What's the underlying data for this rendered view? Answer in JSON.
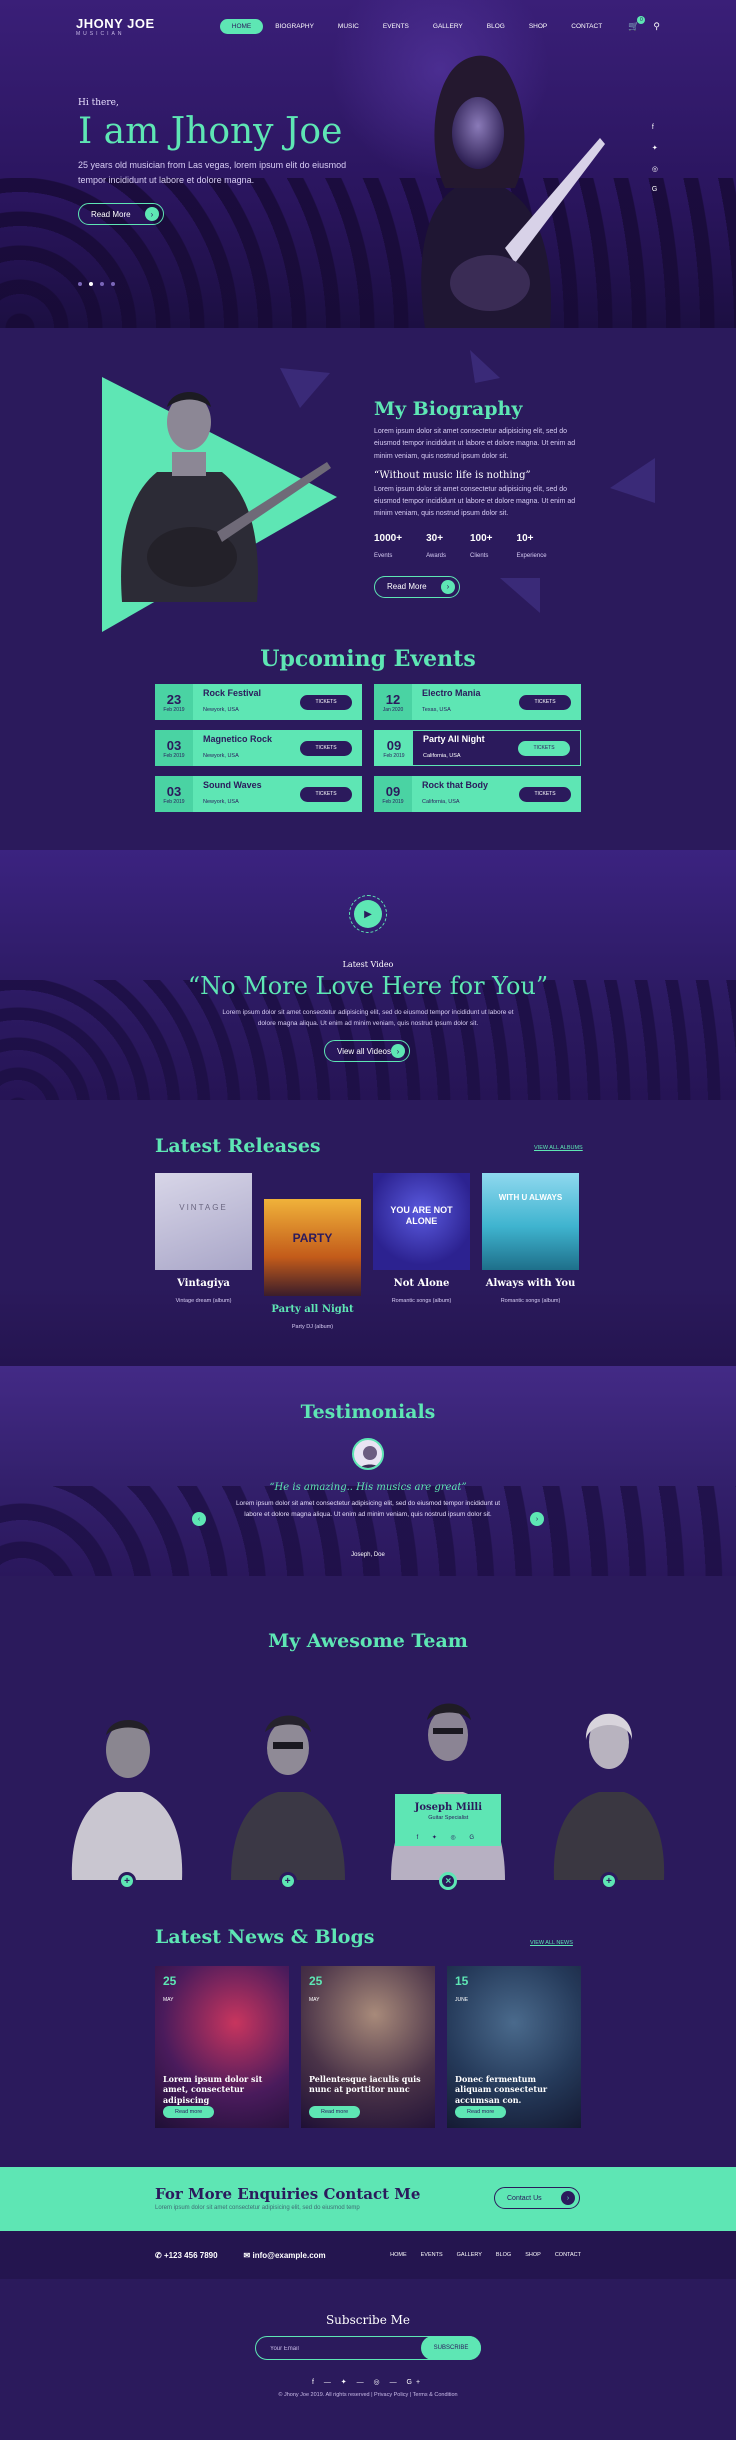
{
  "nav": {
    "logo": "JHONY JOE",
    "logo_sub": "MUSICIAN",
    "items": [
      "HOME",
      "BIOGRAPHY",
      "MUSIC",
      "EVENTS",
      "GALLERY",
      "BLOG",
      "SHOP",
      "CONTACT"
    ],
    "cart_count": "0"
  },
  "hero": {
    "greeting": "Hi there,",
    "title": "I am Jhony Joe",
    "desc": "25 years old musician from Las vegas, lorem ipsum elit do eiusmod tempor incididunt ut labore et dolore magna.",
    "button": "Read More"
  },
  "bio": {
    "title": "My Biography",
    "desc1": "Lorem ipsum dolor sit amet consectetur adipisicing elit, sed do eiusmod tempor incididunt ut labore et dolore magna. Ut enim ad minim veniam, quis nostrud ipsum dolor sit.",
    "quote": "“Without music life is nothing”",
    "desc2": "Lorem ipsum dolor sit amet consectetur adipisicing elit, sed do eiusmod tempor incididunt ut labore et dolore magna. Ut enim ad minim veniam, quis nostrud ipsum dolor sit.",
    "stats": [
      {
        "value": "1000+",
        "label": "Events"
      },
      {
        "value": "30+",
        "label": "Awards"
      },
      {
        "value": "100+",
        "label": "Clients"
      },
      {
        "value": "10+",
        "label": "Experience"
      }
    ],
    "button": "Read More"
  },
  "events": {
    "title": "Upcoming Events",
    "ticket_label": "TICKETS",
    "items": [
      {
        "day": "23",
        "month": "Feb 2019",
        "name": "Rock Festival",
        "place": "Newyork, USA"
      },
      {
        "day": "12",
        "month": "Jan 2020",
        "name": "Electro Mania",
        "place": "Texas, USA"
      },
      {
        "day": "03",
        "month": "Feb 2019",
        "name": "Magnetico Rock",
        "place": "Newyork, USA"
      },
      {
        "day": "09",
        "month": "Feb 2019",
        "name": "Party All Night",
        "place": "California, USA"
      },
      {
        "day": "03",
        "month": "Feb 2019",
        "name": "Sound Waves",
        "place": "Newyork, USA"
      },
      {
        "day": "09",
        "month": "Feb 2019",
        "name": "Rock that Body",
        "place": "California, USA"
      }
    ]
  },
  "video": {
    "label": "Latest Video",
    "title": "“No More Love Here for You”",
    "desc": "Lorem ipsum dolor sit amet consectetur adipisicing elit, sed do eiusmod tempor incididunt ut labore et dolore magna aliqua. Ut enim ad minim veniam, quis nostrud ipsum dolor sit.",
    "button": "View all Videos"
  },
  "releases": {
    "title": "Latest Releases",
    "view_all": "VIEW ALL ALBUMS",
    "items": [
      {
        "name": "Vintagiya",
        "sub": "Vintage dream (album)",
        "cover_text": "VINTAGE"
      },
      {
        "name": "Party all Night",
        "sub": "Party DJ (album)",
        "cover_text": "PARTY"
      },
      {
        "name": "Not Alone",
        "sub": "Romantic songs (album)",
        "cover_text": "YOU ARE NOT ALONE"
      },
      {
        "name": "Always with You",
        "sub": "Romantic songs (album)",
        "cover_text": "WITH U ALWAYS"
      }
    ]
  },
  "testimonials": {
    "title": "Testimonials",
    "quote": "“He is amazing.. His musics are great”",
    "desc": "Lorem ipsum dolor sit amet consectetur adipisicing elit, sed do eiusmod tempor incididunt ut labore et dolore magna aliqua. Ut enim ad minim veniam, quis nostrud ipsum dolor sit.",
    "name": "Joseph, Doe"
  },
  "team": {
    "title": "My Awesome Team",
    "featured": {
      "name": "Joseph Milli",
      "role": "Guitar Specialist",
      "social": "f ✦ ◎ G"
    }
  },
  "news": {
    "title": "Latest News & Blogs",
    "view_all": "VIEW ALL NEWS",
    "read_more": "Read more",
    "items": [
      {
        "day": "25",
        "month": "MAY",
        "title": "Lorem ipsum dolor sit amet, consectetur adipiscing"
      },
      {
        "day": "25",
        "month": "MAY",
        "title": "Pellentesque iaculis quis nunc at porttitor nunc"
      },
      {
        "day": "15",
        "month": "JUNE",
        "title": "Donec fermentum aliquam consectetur accumsan con."
      }
    ]
  },
  "contact": {
    "title": "For More Enquiries Contact Me",
    "desc": "Lorem ipsum dolor sit amet consectetur adipisicing elit, sed do eiusmod temp",
    "button": "Contact Us"
  },
  "footer": {
    "phone": "+123 456 7890",
    "email": "info@example.com",
    "menu": [
      "HOME",
      "EVENTS",
      "GALLERY",
      "BLOG",
      "SHOP",
      "CONTACT"
    ],
    "subscribe_title": "Subscribe Me",
    "email_placeholder": "Your Email",
    "subscribe_button": "SUBSCRIBE",
    "social": "f — ✦ — ◎ — G+",
    "copyright": "© Jhony Joe 2019. All rights reserved  |  Privacy Policy  |  Terms & Condition"
  },
  "colors": {
    "bg": "#2b1a5c",
    "accent": "#5ee6b4"
  }
}
